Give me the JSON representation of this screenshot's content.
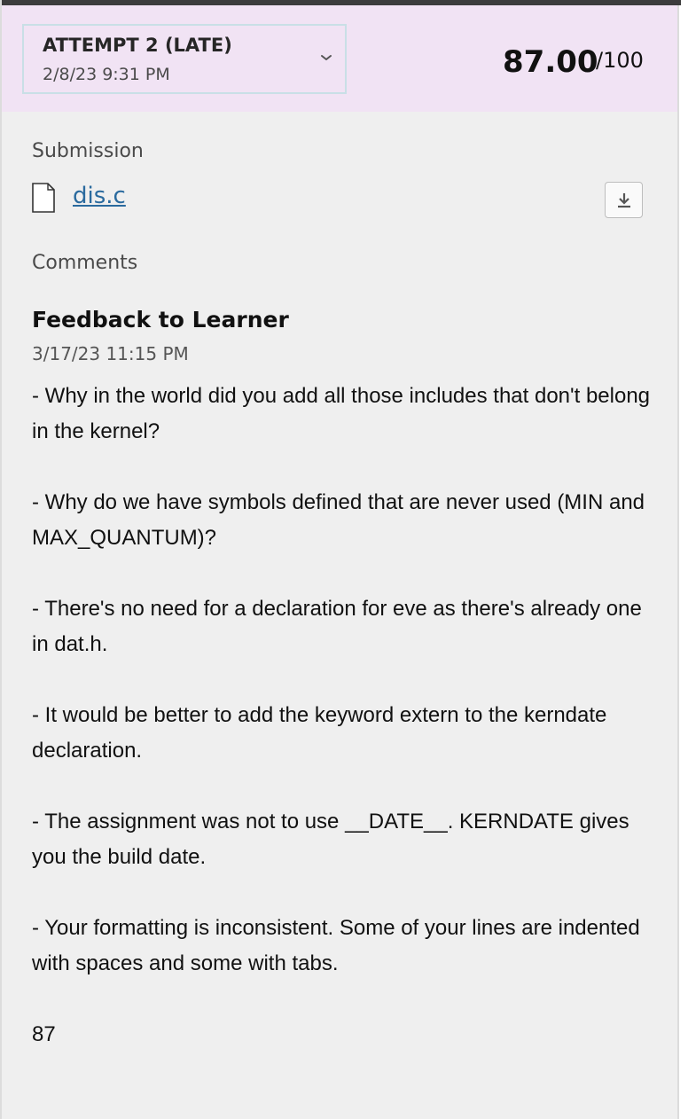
{
  "attempt": {
    "label": "ATTEMPT 2 (LATE)",
    "date": "2/8/23 9:31 PM",
    "score": "87.00",
    "score_max": "/100"
  },
  "submission": {
    "section_label": "Submission",
    "file_name": "dis.c"
  },
  "comments": {
    "section_label": "Comments",
    "title": "Feedback to Learner",
    "date": "3/17/23 11:15 PM",
    "paragraphs": [
      "- Why in the world did you add all those includes that don't belong in the kernel?",
      "- Why do we have symbols defined that are never used (MIN and MAX_QUANTUM)?",
      "- There's no need for a declaration for eve as there's already one in dat.h.",
      "- It would be better to add the keyword extern to the kerndate declaration.",
      "- The assignment was not to use __DATE__.  KERNDATE gives you the build date.",
      "- Your formatting is inconsistent.  Some of your lines are indented with spaces and some with tabs.",
      "87"
    ]
  },
  "colors": {
    "header_bg": "#f1e3f4",
    "panel_bg": "#efefef",
    "link": "#2a6a9e"
  }
}
